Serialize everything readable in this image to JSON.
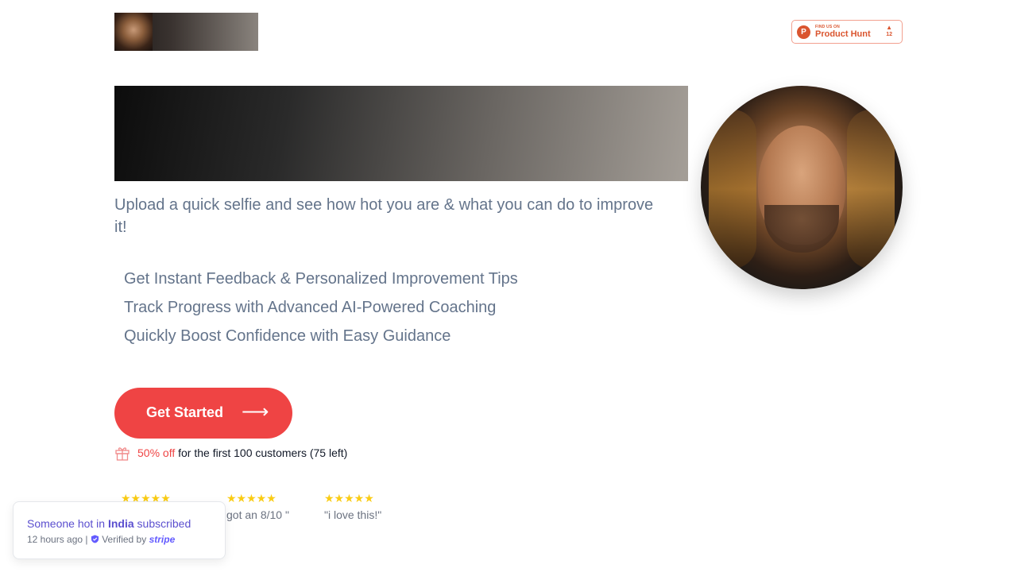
{
  "header": {
    "product_hunt": {
      "find_us_on": "FIND US ON",
      "name": "Product Hunt",
      "upvote_arrow": "▲",
      "count": "12"
    }
  },
  "hero": {
    "subtitle": "Upload a quick selfie and see how hot you are & what you can do to improve it!",
    "features": [
      "Get Instant Feedback & Personalized Improvement Tips",
      "Track Progress with Advanced AI-Powered Coaching",
      "Quickly Boost Confidence with Easy Guidance"
    ],
    "cta_label": "Get Started",
    "cta_arrow": "⟶"
  },
  "offer": {
    "highlight": "50% off",
    "rest": " for the first 100 customers (75 left)"
  },
  "reviews": [
    {
      "stars": "★★★★★",
      "quote": ""
    },
    {
      "stars": "★★★★★",
      "quote": "got an 8/10  \""
    },
    {
      "stars": "★★★★★",
      "quote": "\"i love this!\""
    }
  ],
  "toast": {
    "prefix": "Someone hot in ",
    "country": "India",
    "suffix": " subscribed",
    "time": "12 hours ago | ",
    "verified": "Verified by ",
    "brand": "stripe"
  },
  "colors": {
    "accent": "#ef4444",
    "text_muted": "#64748b",
    "star": "#facc15",
    "toast_text": "#5b4fcf",
    "product_hunt": "#da552f"
  }
}
